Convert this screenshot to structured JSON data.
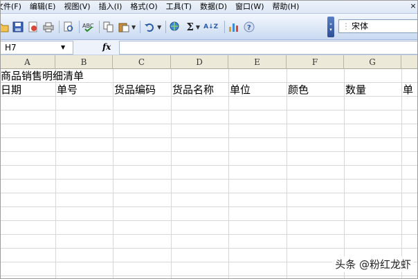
{
  "menubar": {
    "items": [
      "文件(F)",
      "编辑(E)",
      "视图(V)",
      "插入(I)",
      "格式(O)",
      "工具(T)",
      "数据(D)",
      "窗口(W)",
      "帮助(H)"
    ]
  },
  "toolbar": {
    "buttons": [
      "open-icon",
      "save-icon",
      "permission-icon",
      "print-icon",
      "print-preview-icon",
      "spelling-icon",
      "copy-icon",
      "paste-icon",
      "undo-icon",
      "hyperlink-icon",
      "autosum-icon",
      "sort-ascending-icon",
      "chart-icon",
      "help-icon"
    ],
    "autosum_symbol": "Σ",
    "sort_symbol": "A↓Z",
    "font_name": "宋体"
  },
  "formula_bar": {
    "name_box": "H7",
    "fx_label": "fx",
    "formula": ""
  },
  "sheet": {
    "columns": [
      "A",
      "B",
      "C",
      "D",
      "E",
      "F",
      "G"
    ],
    "title": "商品销售明细清单",
    "headers": [
      "日期",
      "单号",
      "货品编码",
      "货品名称",
      "单位",
      "颜色",
      "数量",
      "单"
    ]
  },
  "watermark": "头条 @粉红龙虾",
  "colors": {
    "menubar_bg": "#dde7f5",
    "toolbar_bg": "#c9d9f1",
    "column_header_bg": "#ece9d8",
    "gridline": "#d6d6d6"
  }
}
